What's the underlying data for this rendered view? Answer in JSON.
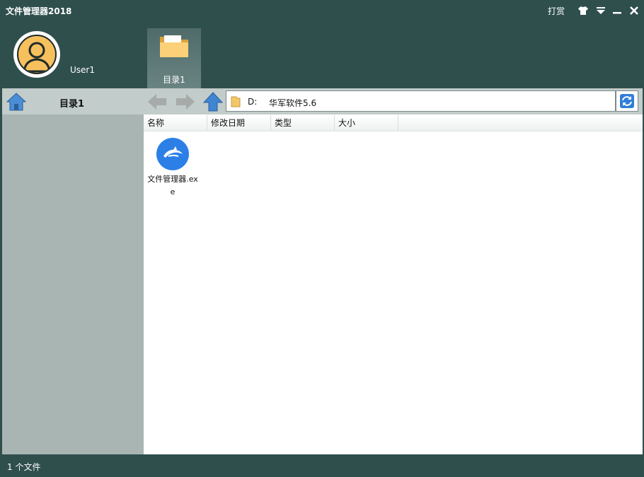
{
  "app": {
    "title": "文件管理器2018",
    "reward_label": "打赏"
  },
  "window_controls": {
    "skin_icon": "shirt-icon",
    "menu_icon": "dropdown-menu-icon",
    "minimize_icon": "minimize-icon",
    "close_icon": "close-icon"
  },
  "user": {
    "name": "User1",
    "avatar_icon": "user-avatar-icon"
  },
  "tabs": [
    {
      "label": "目录1",
      "icon": "folder-icon"
    }
  ],
  "sidebar": {
    "title": "目录1",
    "home_icon": "home-icon"
  },
  "toolbar": {
    "back_icon": "back-arrow-icon",
    "forward_icon": "forward-arrow-icon",
    "up_icon": "up-arrow-icon",
    "refresh_icon": "refresh-icon"
  },
  "address": {
    "drive": "D:",
    "path": "华军软件5.6",
    "icon": "folder-icon"
  },
  "columns": [
    "名称",
    "修改日期",
    "类型",
    "大小"
  ],
  "files": [
    {
      "name": "文件管理器.exe",
      "icon": "dolphin-app-icon"
    }
  ],
  "status": {
    "text": "1 个文件"
  },
  "colors": {
    "frame": "#2f4f4d",
    "sidebar": "#a8b5b3",
    "toolbar": "#c2ccca",
    "accent": "#2c7fe6"
  }
}
